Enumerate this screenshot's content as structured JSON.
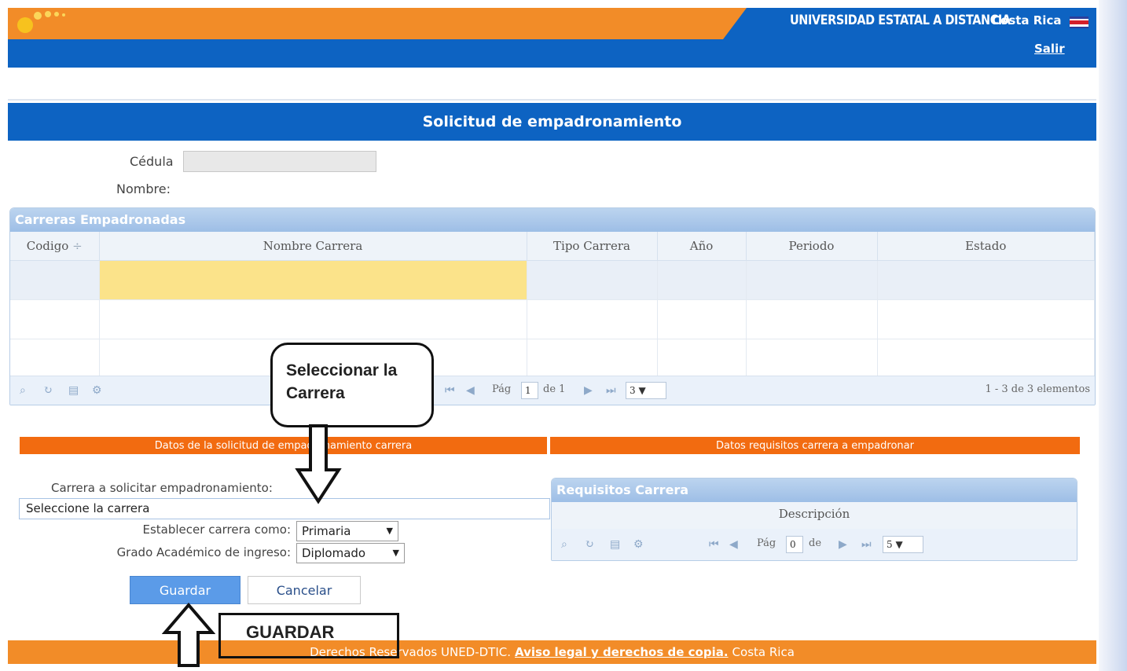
{
  "header": {
    "university": "UNIVERSIDAD ESTATAL A DISTANCIA",
    "country": "Costa Rica",
    "logout": "Salir"
  },
  "page": {
    "title": "Solicitud de empadronamiento",
    "cedula_label": "Cédula",
    "nombre_label": "Nombre:"
  },
  "grid": {
    "caption": "Carreras Empadronadas",
    "columns": [
      "Codigo",
      "Nombre Carrera",
      "Tipo Carrera",
      "Año",
      "Periodo",
      "Estado"
    ],
    "sort_indicator": "÷",
    "pager": {
      "page_label": "Pág",
      "page_value": "1",
      "of_label": "de 1",
      "page_size": "3",
      "summary": "1 - 3 de 3 elementos"
    }
  },
  "annotations": {
    "callout": "Seleccionar la Carrera",
    "guardar": "GUARDAR"
  },
  "sections": {
    "left": "Datos de la solicitud de empadronamiento carrera",
    "right": "Datos requisitos carrera a empadronar"
  },
  "form": {
    "carrera_label": "Carrera a solicitar empadronamiento:",
    "carrera_value": "Seleccione la carrera",
    "establecer_label": "Establecer carrera como:",
    "establecer_value": "Primaria",
    "grado_label": "Grado Académico de ingreso:",
    "grado_value": "Diplomado",
    "save": "Guardar",
    "cancel": "Cancelar"
  },
  "requisitos": {
    "caption": "Requisitos Carrera",
    "column": "Descripción",
    "pager": {
      "page_label": "Pág",
      "page_value": "0",
      "of_label": "de",
      "page_size": "5"
    }
  },
  "footer": {
    "prefix": "Derechos Reservados UNED-DTIC.",
    "link": "Aviso legal y derechos de copia.",
    "suffix": "Costa Rica"
  },
  "colors": {
    "brand_orange": "#f28c28",
    "brand_blue": "#0d63c2",
    "section_orange": "#f26b10",
    "selected_cell": "#fbe38a"
  }
}
